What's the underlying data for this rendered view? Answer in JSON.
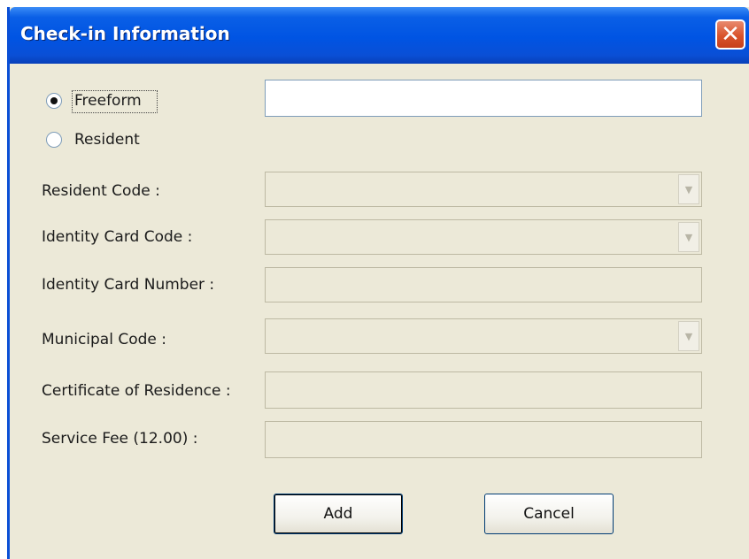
{
  "window": {
    "title": "Check-in Information"
  },
  "title_buttons": {
    "close_glyph": "✕"
  },
  "form": {
    "freeform_label": "Freeform",
    "freeform_selected": true,
    "freeform_value": "",
    "resident_label": "Resident",
    "resident_selected": false,
    "resident_code_label": "Resident Code :",
    "resident_code_value": "",
    "identity_card_code_label": "Identity Card Code :",
    "identity_card_code_value": "",
    "identity_card_number_label": "Identity Card Number :",
    "identity_card_number_value": "",
    "municipal_code_label": "Municipal Code :",
    "municipal_code_value": "",
    "certificate_label": "Certificate of Residence :",
    "certificate_value": "",
    "service_fee_label": "Service Fee (12.00) :",
    "service_fee_value": ""
  },
  "buttons": {
    "add_label": "Add",
    "cancel_label": "Cancel"
  },
  "icons": {
    "close": "close-icon",
    "dropdown": "chevron-down-icon"
  },
  "colors": {
    "titlebar": "#0054e3",
    "close": "#d9542c",
    "dialog_bg": "#ece9d8"
  }
}
